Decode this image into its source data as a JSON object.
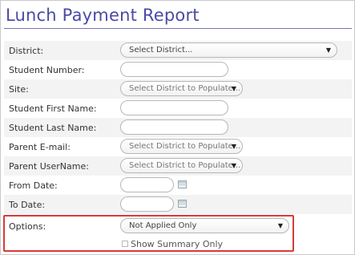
{
  "page": {
    "title": "Lunch Payment Report"
  },
  "form": {
    "district": {
      "label": "District:",
      "value": "Select District..."
    },
    "student_number": {
      "label": "Student Number:",
      "value": ""
    },
    "site": {
      "label": "Site:",
      "value": "Select District to Populate..."
    },
    "student_first_name": {
      "label": "Student First Name:",
      "value": ""
    },
    "student_last_name": {
      "label": "Student Last Name:",
      "value": ""
    },
    "parent_email": {
      "label": "Parent E-mail:",
      "value": "Select District to Populate..."
    },
    "parent_username": {
      "label": "Parent UserName:",
      "value": "Select District to Populate..."
    },
    "from_date": {
      "label": "From Date:",
      "value": ""
    },
    "to_date": {
      "label": "To Date:",
      "value": ""
    },
    "options": {
      "label": "Options:",
      "value": "Not Applied Only"
    },
    "show_summary": {
      "label": "Show Summary Only",
      "checked": false
    }
  },
  "icons": {
    "dropdown": "chevron-down-icon",
    "calendar": "calendar-icon"
  },
  "colors": {
    "title": "#4b4aa6",
    "title_rule": "#7574b8",
    "highlight": "#d63a3a"
  }
}
